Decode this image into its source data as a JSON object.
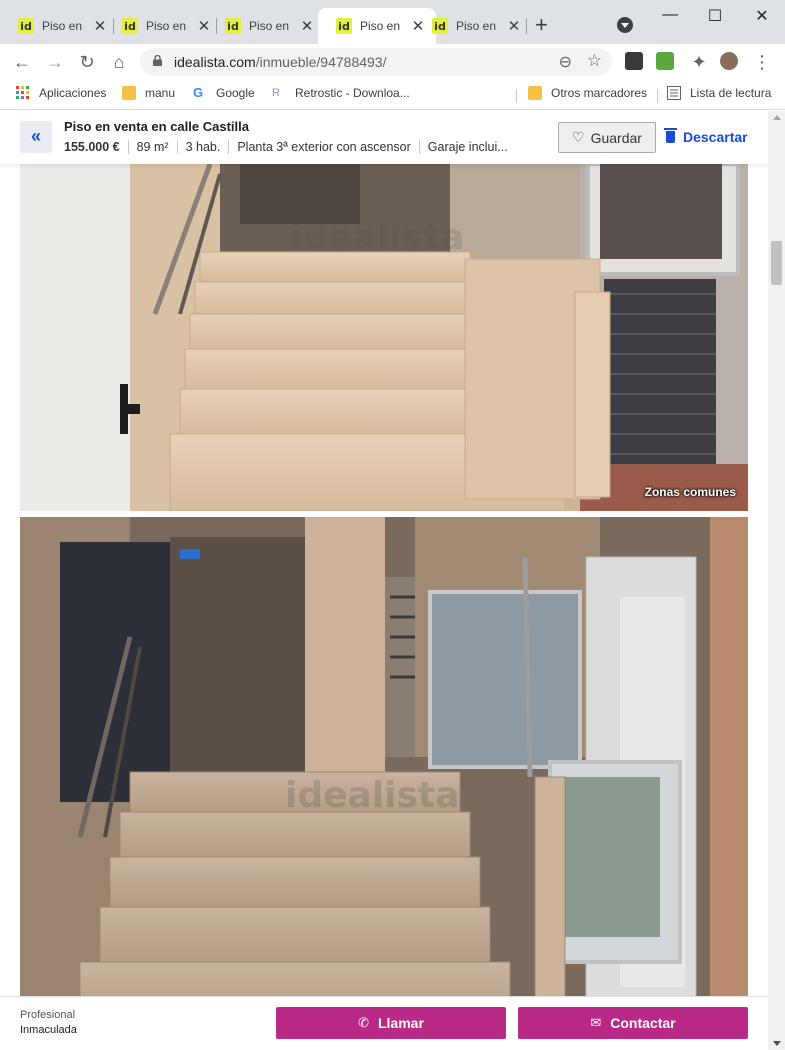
{
  "browser": {
    "tabs": [
      {
        "favicon": "id",
        "title": "Piso en venta en calle Castilla",
        "active": false
      },
      {
        "favicon": "id",
        "title": "Piso en venta",
        "active": false
      },
      {
        "favicon": "id",
        "title": "Piso en venta",
        "active": false
      },
      {
        "favicon": "id",
        "title": "Piso en venta",
        "active": true
      },
      {
        "favicon": "id",
        "title": "Piso en venta",
        "active": false
      }
    ],
    "new_tab": "+",
    "url_host": "idealista.com",
    "url_path": "/inmueble/94788493/",
    "bookmarks": [
      {
        "label": "Aplicaciones",
        "icon": "apps-grid-icon"
      },
      {
        "label": "manu",
        "icon": "folder-icon"
      },
      {
        "label": "Google",
        "icon": "google-icon"
      },
      {
        "label": "Retrostic - Downloa...",
        "icon": "retrostic-icon"
      },
      {
        "label": "Otros marcadores",
        "icon": "folder-icon"
      },
      {
        "label": "Lista de lectura",
        "icon": "reading-list-icon"
      }
    ]
  },
  "listing": {
    "title": "Piso en venta en calle Castilla",
    "price": "155.000 €",
    "area": "89 m²",
    "rooms": "3 hab.",
    "floor": "Planta 3ª exterior con ascensor",
    "garage": "Garaje inclui...",
    "save_label": "Guardar",
    "discard_label": "Descartar"
  },
  "photos": [
    {
      "caption": "Zonas comunes",
      "watermark": "idealista"
    },
    {
      "caption": "",
      "watermark": "idealista"
    }
  ],
  "contact": {
    "advertiser_type": "Profesional",
    "advertiser_name": "Inmaculada",
    "call_label": "Llamar",
    "contact_label": "Contactar"
  },
  "colors": {
    "accent_blue": "#1a4bd6",
    "cta_magenta": "#b92a87",
    "favicon_yellow": "#e3ef3a"
  }
}
